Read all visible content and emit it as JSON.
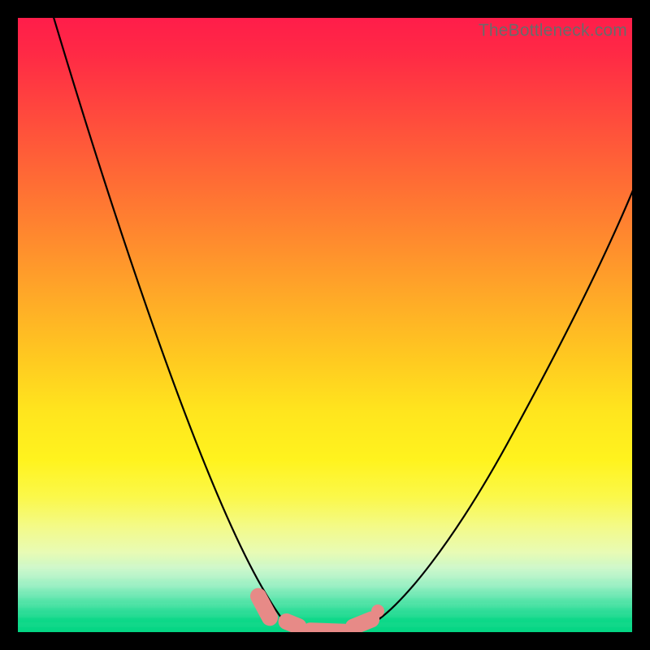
{
  "watermark": "TheBottleneck.com",
  "colors": {
    "frame": "#000000",
    "marker": "#e78a87",
    "curve": "#000000",
    "watermark": "#6a6a6a"
  },
  "chart_data": {
    "type": "line",
    "title": "",
    "xlabel": "",
    "ylabel": "",
    "xlim": [
      0,
      100
    ],
    "ylim": [
      0,
      100
    ],
    "note": "Axes are unlabeled in the image. Y represents bottleneck severity (high at top/red, low at bottom/green). X is an implied component-balance axis. Values are pixel-read estimates on a 0–100 normalized grid.",
    "series": [
      {
        "name": "left-curve",
        "x": [
          6,
          12,
          18,
          24,
          30,
          35,
          39,
          42,
          44
        ],
        "y": [
          100,
          82,
          64,
          46,
          29,
          16,
          8,
          3,
          1
        ]
      },
      {
        "name": "valley-floor",
        "x": [
          44,
          50,
          57
        ],
        "y": [
          1,
          0.5,
          1
        ]
      },
      {
        "name": "right-curve",
        "x": [
          57,
          62,
          68,
          75,
          82,
          90,
          98,
          100
        ],
        "y": [
          1,
          4,
          10,
          20,
          33,
          50,
          68,
          73
        ]
      }
    ],
    "markers": [
      {
        "name": "left-edge-marker",
        "x": 40.5,
        "y": 5,
        "orientation": "diagonal"
      },
      {
        "name": "worm-segment-1",
        "x": 44,
        "y": 1.2,
        "orientation": "diagonal-short"
      },
      {
        "name": "worm-segment-2",
        "x": 49,
        "y": 0.5,
        "orientation": "horizontal"
      },
      {
        "name": "worm-segment-3",
        "x": 55,
        "y": 1.5,
        "orientation": "diagonal-up"
      },
      {
        "name": "right-dot-marker",
        "x": 58,
        "y": 3,
        "orientation": "dot"
      }
    ],
    "gradient_stops": [
      {
        "pct": 0,
        "color": "#ff1d4a"
      },
      {
        "pct": 36,
        "color": "#ff8a2e"
      },
      {
        "pct": 64,
        "color": "#ffe51e"
      },
      {
        "pct": 90,
        "color": "#c7f7cb"
      },
      {
        "pct": 100,
        "color": "#03d583"
      }
    ]
  }
}
